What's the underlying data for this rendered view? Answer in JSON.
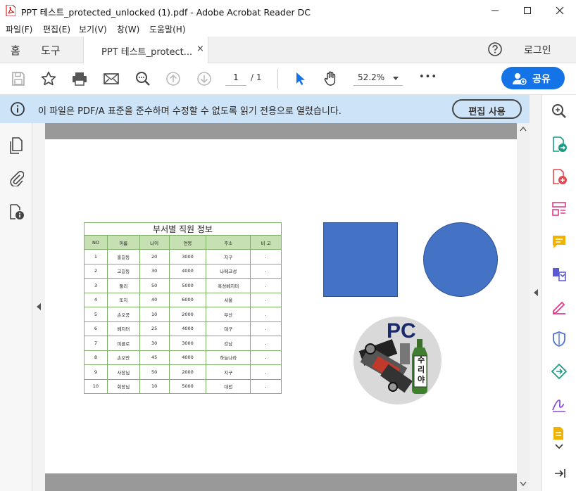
{
  "window": {
    "title": "PPT 테스트_protected_unlocked (1).pdf - Adobe Acrobat Reader DC",
    "icon": "acrobat-pdf-icon"
  },
  "menu": [
    "파일(F)",
    "편집(E)",
    "보기(V)",
    "창(W)",
    "도움말(H)"
  ],
  "tabs": {
    "home": "홈",
    "tools": "도구",
    "document": "PPT 테스트_protect...",
    "close": "×",
    "login": "로그인"
  },
  "toolbar": {
    "page_current": "1",
    "page_total": "/ 1",
    "zoom": "52.2%",
    "more": "•••",
    "share": "공유"
  },
  "info": {
    "message": "이 파일은 PDF/A 표준을 준수하며 수정할 수 없도록 읽기 전용으로 열렸습니다.",
    "edit_button": "편집 사용"
  },
  "colors": {
    "accent": "#1473e6",
    "infobar": "#cde3f7",
    "table_header": "#c6e0b4",
    "table_border": "#7fb06a",
    "shape_fill": "#4472c4"
  },
  "document": {
    "table": {
      "title": "부서별 직원 정보",
      "headers": [
        "NO",
        "이름",
        "나이",
        "연봉",
        "주소",
        "비 고"
      ],
      "rows": [
        [
          "1",
          "홍길동",
          "20",
          "3000",
          "지구",
          "."
        ],
        [
          "2",
          "고길동",
          "30",
          "4000",
          "나메크성",
          "."
        ],
        [
          "3",
          "둘리",
          "50",
          "5000",
          "혹성베지터",
          "."
        ],
        [
          "4",
          "또치",
          "40",
          "6000",
          "서울",
          "."
        ],
        [
          "5",
          "손오공",
          "10",
          "2000",
          "부산",
          "."
        ],
        [
          "6",
          "베지터",
          "25",
          "4000",
          "대구",
          "."
        ],
        [
          "7",
          "피콜로",
          "30",
          "3000",
          "강남",
          "."
        ],
        [
          "8",
          "손오반",
          "45",
          "4000",
          "하늘나라",
          "."
        ],
        [
          "9",
          "사장님",
          "50",
          "2000",
          "지구",
          "."
        ],
        [
          "10",
          "회장님",
          "10",
          "5000",
          "대전",
          "."
        ]
      ]
    },
    "logo": {
      "text": "PC",
      "bottle_text": "수리야"
    }
  }
}
